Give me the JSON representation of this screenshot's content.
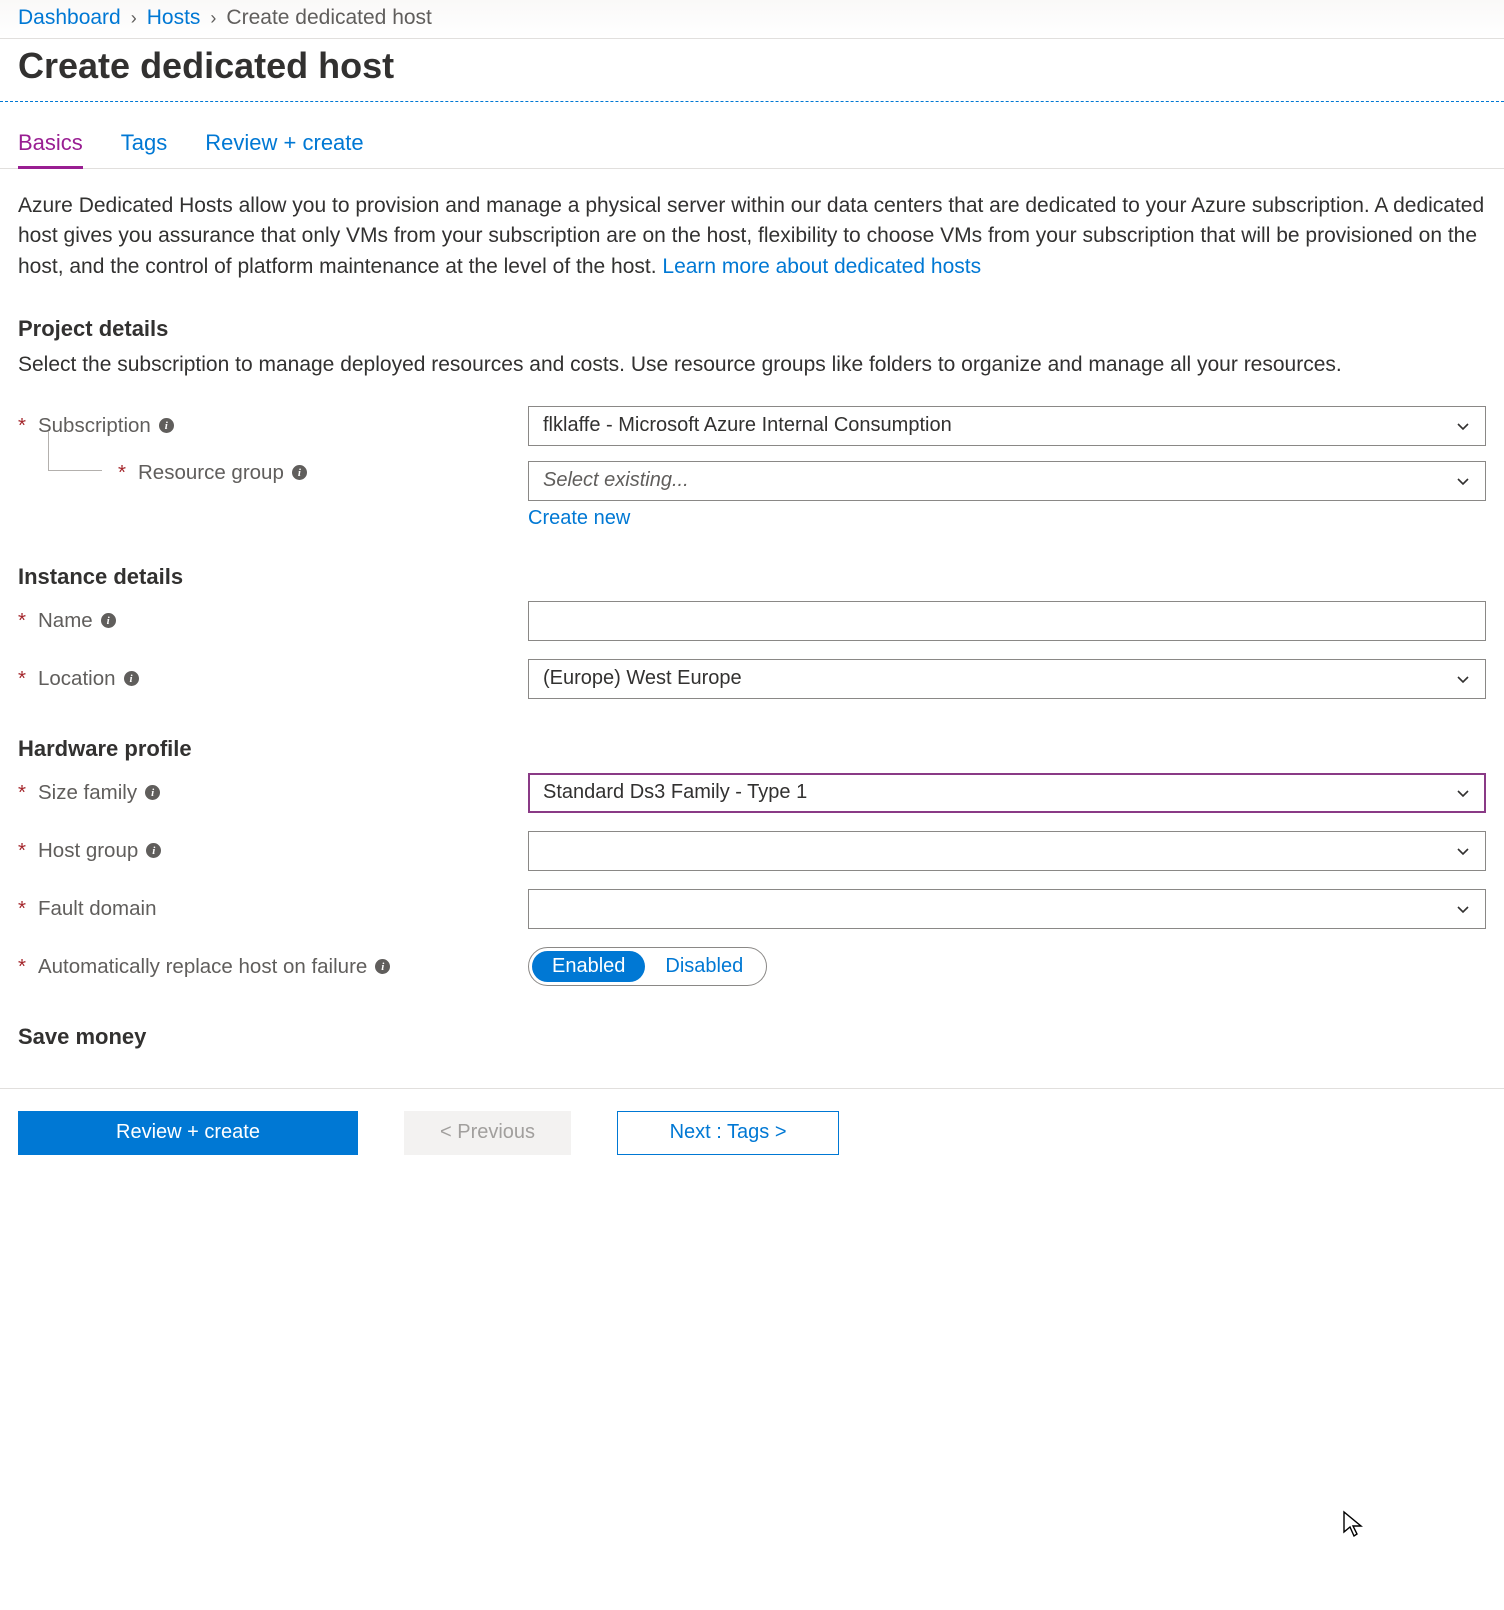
{
  "breadcrumb": {
    "items": [
      {
        "label": "Dashboard",
        "link": true
      },
      {
        "label": "Hosts",
        "link": true
      },
      {
        "label": "Create dedicated host",
        "link": false
      }
    ]
  },
  "page_title": "Create dedicated host",
  "tabs": [
    {
      "label": "Basics",
      "active": true
    },
    {
      "label": "Tags",
      "active": false
    },
    {
      "label": "Review + create",
      "active": false
    }
  ],
  "intro": {
    "text": "Azure Dedicated Hosts allow you to provision and manage a physical server within our data centers that are dedicated to your Azure subscription. A dedicated host gives you assurance that only VMs from your subscription are on the host, flexibility to choose VMs from your subscription that will be provisioned on the host, and the control of platform maintenance at the level of the host.  ",
    "link_label": "Learn more about dedicated hosts"
  },
  "sections": {
    "project": {
      "heading": "Project details",
      "description": "Select the subscription to manage deployed resources and costs. Use resource groups like folders to organize and manage all your resources.",
      "subscription_label": "Subscription",
      "subscription_value": "flklaffe - Microsoft Azure Internal Consumption",
      "resource_group_label": "Resource group",
      "resource_group_placeholder": "Select existing...",
      "create_new_label": "Create new"
    },
    "instance": {
      "heading": "Instance details",
      "name_label": "Name",
      "name_value": "",
      "location_label": "Location",
      "location_value": "(Europe) West Europe"
    },
    "hardware": {
      "heading": "Hardware profile",
      "size_family_label": "Size family",
      "size_family_value": "Standard Ds3 Family - Type 1",
      "host_group_label": "Host group",
      "host_group_value": "",
      "fault_domain_label": "Fault domain",
      "fault_domain_value": "",
      "auto_replace_label": "Automatically replace host on failure",
      "auto_replace_enabled_label": "Enabled",
      "auto_replace_disabled_label": "Disabled"
    },
    "save": {
      "heading": "Save money"
    }
  },
  "footer": {
    "review_label": "Review + create",
    "previous_label": "< Previous",
    "next_label": "Next : Tags >"
  }
}
